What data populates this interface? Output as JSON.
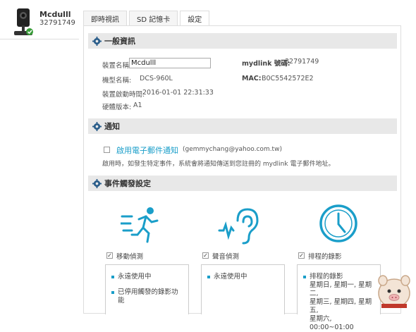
{
  "device": {
    "name": "Mcdulll",
    "id": "32791749"
  },
  "tabs": [
    "即時視訊",
    "SD 記憶卡",
    "設定"
  ],
  "general": {
    "title": "一般資訊",
    "name_label": "裝置名稱:",
    "name_value": "Mcdulll",
    "model_label": "機型名稱:",
    "model_value": "DCS-960L",
    "activation_label": "裝置啟動時間:",
    "activation_value": "2016-01-01 22:31:33",
    "hw_label": "硬體版本:",
    "hw_value": "A1",
    "mydlink_label": "mydlink 號碼:",
    "mydlink_value": "32791749",
    "mac_label": "MAC:",
    "mac_value": "B0C5542572E2"
  },
  "notify": {
    "title": "通知",
    "link_label": "啟用電子郵件通知",
    "email": "(gemmychang@yahoo.com.tw)",
    "description": "啟用時，如發生特定事件，系統會將通知傳送到您註冊的 mydlink 電子郵件地址。"
  },
  "events": {
    "title": "事件觸發設定",
    "items": [
      {
        "label": "移動偵測",
        "icon": "running-person-icon",
        "checked": true,
        "lines": [
          "永遠使用中",
          "已停用觸發的錄影功能"
        ]
      },
      {
        "label": "聲音偵測",
        "icon": "ear-sound-icon",
        "checked": true,
        "lines": [
          "永遠使用中"
        ]
      },
      {
        "label": "排程的錄影",
        "icon": "clock-icon",
        "checked": true,
        "lines": [
          "排程的錄影\n星期日, 星期一, 星期二,\n星期三, 星期四, 星期五,\n星期六, 00:00~01:00"
        ]
      }
    ]
  },
  "colors": {
    "accent": "#1a9ec9",
    "header_bg": "#e8e8e8"
  }
}
